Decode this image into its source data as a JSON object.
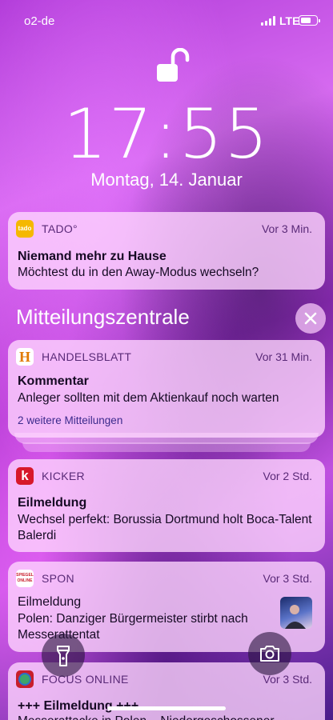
{
  "status_bar": {
    "carrier": "o2-de",
    "network": "LTE",
    "battery_level": 0.7
  },
  "lock_screen": {
    "time": "17:55",
    "date": "Montag, 14. Januar",
    "lock_state": "unlocked"
  },
  "notification_center": {
    "title": "Mitteilungszentrale",
    "close_icon": "close-icon"
  },
  "notifications": [
    {
      "app": "TADO°",
      "icon_text": "tado",
      "icon_color": "#f5b800",
      "time": "Vor 3 Min.",
      "title": "Niemand mehr zu Hause",
      "body": "Möchtest du in den Away-Modus wechseln?"
    },
    {
      "app": "HANDELSBLATT",
      "icon_text": "H",
      "icon_color": "#ffffff",
      "time": "Vor 31 Min.",
      "title": "Kommentar",
      "body": "Anleger sollten mit dem Aktienkauf noch warten",
      "more": "2 weitere Mitteilungen"
    },
    {
      "app": "KICKER",
      "icon_text": "k",
      "icon_color": "#d7182a",
      "time": "Vor 2 Std.",
      "title": "Eilmeldung",
      "body": "Wechsel perfekt: Borussia Dortmund holt Boca-Talent Balerdi"
    },
    {
      "app": "SPON",
      "icon_text": "SPIEGEL ONLINE",
      "icon_color": "#ffffff",
      "time": "Vor 3 Std.",
      "title": "Eilmeldung",
      "body": "Polen: Danziger Bürgermeister stirbt nach Messerattentat"
    },
    {
      "app": "FOCUS ONLINE",
      "icon_color": "#c81e2c",
      "time": "Vor 3 Std.",
      "title": "+++ Eilmeldung +++",
      "body": "Messerattacke in Polen – Niedergeschossener"
    }
  ],
  "quick_actions": {
    "flashlight": "flashlight-icon",
    "camera": "camera-icon"
  }
}
